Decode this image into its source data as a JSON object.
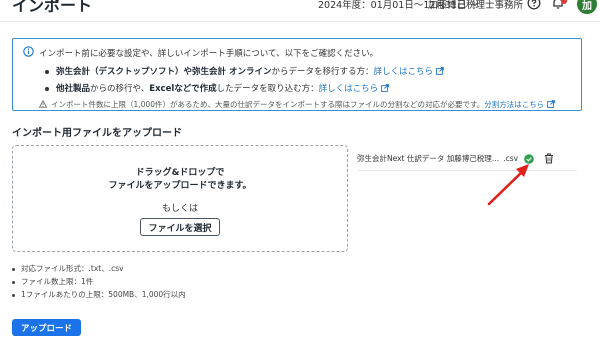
{
  "header": {
    "title": "インポート",
    "period": "2024年度：01月01日〜12月31日",
    "office": "加藤博己税理士事務所",
    "avatar_text": "加",
    "icons": [
      "chevron-down-icon",
      "help-icon",
      "bell-icon"
    ]
  },
  "info": {
    "line1": "インポート前に必要な設定や、詳しいインポート手順について、以下をご確認ください。",
    "line2_a": "弥生会計（デスクトップソフト）や弥生会計 オンライン",
    "line2_b": "からデータを移行する方：",
    "line2_link": "詳しくはこちら",
    "line3_a": "他社製品",
    "line3_b": "からの移行や、",
    "line3_c": "Excelなどで作成",
    "line3_d": "したデータを取り込む方：",
    "line3_link": "詳しくはこちら",
    "line4": "インポート件数に上限（1,000件）があるため、大量の仕訳データをインポートする際はファイルの分割などの対応が必要です。",
    "line4_link": "分割方法はこちら"
  },
  "upload": {
    "section_title": "インポート用ファイルをアップロード",
    "drop_line1": "ドラッグ&ドロップで",
    "drop_line2": "ファイルをアップロードできます。",
    "or_text": "もしくは",
    "select_label": "ファイルを選択"
  },
  "file": {
    "name": "弥生会計Next 仕訳データ 加藤博己税理…",
    "ext": ".csv",
    "status": "uploaded",
    "accent": "#2e9e4f"
  },
  "notes": [
    "対応ファイル形式：.txt、.csv",
    "ファイル数上限：1件",
    "1ファイルあたりの上限：500MB、1,000行以内"
  ],
  "upload_button": "アップロード",
  "colors": {
    "primary": "#1a73e8",
    "link": "#1a73c9",
    "info_border": "#3a8fd6",
    "annotation_arrow": "#e0201b"
  }
}
